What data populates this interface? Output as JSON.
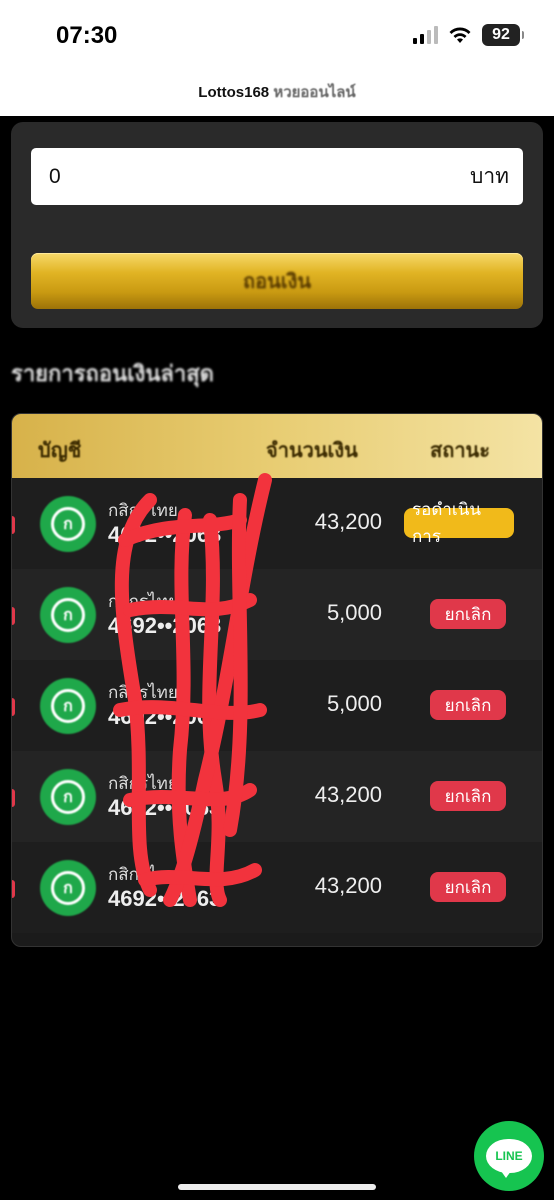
{
  "status_bar": {
    "time": "07:30",
    "battery": "92"
  },
  "header": {
    "site_name": "Lottos168",
    "site_suffix": "หวยออนไลน์"
  },
  "withdraw_form": {
    "amount_value": "0",
    "currency": "บาท",
    "submit_label": "ถอนเงิน"
  },
  "history": {
    "heading": "รายการถอนเงินล่าสุด",
    "columns": [
      "บัญชี",
      "จำนวนเงิน",
      "สถานะ"
    ],
    "rows": [
      {
        "bank": "กสิกรไทย",
        "account": "4692••2063",
        "amount": "43,200",
        "status": "รอดำเนินการ",
        "status_color": "#f1ba1a"
      },
      {
        "bank": "กสิกรไทย",
        "account": "4692••2063",
        "amount": "5,000",
        "status": "ยกเลิก",
        "status_color": "#e0384a"
      },
      {
        "bank": "กสิกรไทย",
        "account": "4692••2063",
        "amount": "5,000",
        "status": "ยกเลิก",
        "status_color": "#e0384a"
      },
      {
        "bank": "กสิกรไทย",
        "account": "4692••2063",
        "amount": "43,200",
        "status": "ยกเลิก",
        "status_color": "#e0384a"
      },
      {
        "bank": "กสิกรไทย",
        "account": "4692••2063",
        "amount": "43,200",
        "status": "ยกเลิก",
        "status_color": "#e0384a"
      }
    ]
  },
  "line_button": {
    "label": "LINE",
    "color": "#16c450"
  },
  "colors": {
    "gold": "#e1b424",
    "cancel": "#e0384a",
    "pending": "#f1ba1a",
    "scribble": "#f2333d"
  }
}
